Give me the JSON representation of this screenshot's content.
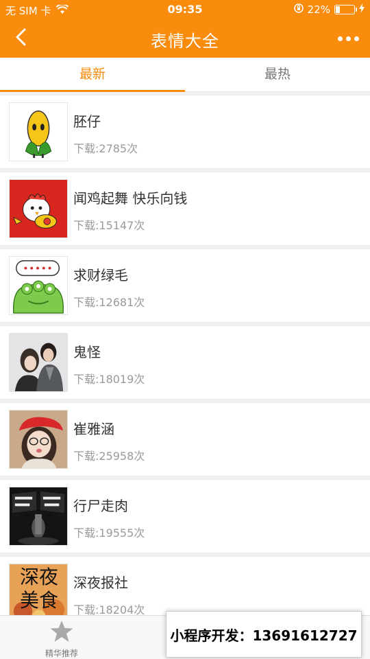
{
  "status_bar": {
    "carrier": "无 SIM 卡",
    "time": "09:35",
    "battery": "22%",
    "battery_level": 0.22
  },
  "nav": {
    "title": "表情大全"
  },
  "tabs": [
    {
      "label": "最新",
      "active": true
    },
    {
      "label": "最热",
      "active": false
    }
  ],
  "items": [
    {
      "title": "胚仔",
      "downloads": "下载:2785次",
      "icon": "corn-sticker-thumbnail"
    },
    {
      "title": "闻鸡起舞 快乐向钱",
      "downloads": "下载:15147次",
      "icon": "rooster-sticker-thumbnail"
    },
    {
      "title": "求财绿毛",
      "downloads": "下载:12681次",
      "icon": "green-monster-sticker-thumbnail"
    },
    {
      "title": "鬼怪",
      "downloads": "下载:18019次",
      "icon": "goblin-drama-thumbnail"
    },
    {
      "title": "崔雅涵",
      "downloads": "下载:25958次",
      "icon": "girl-red-hat-thumbnail"
    },
    {
      "title": "行尸走肉",
      "downloads": "下载:19555次",
      "icon": "walking-dead-thumbnail"
    },
    {
      "title": "深夜报社",
      "downloads": "下载:18204次",
      "icon": "late-night-food-thumbnail",
      "thumb_text": [
        "深夜",
        "美食"
      ]
    }
  ],
  "tabbar": {
    "featured_label": "精华推荐",
    "featured_icon": "star-icon"
  },
  "promo": {
    "text": "小程序开发：13691612727"
  },
  "colors": {
    "accent": "#f98c0c"
  }
}
